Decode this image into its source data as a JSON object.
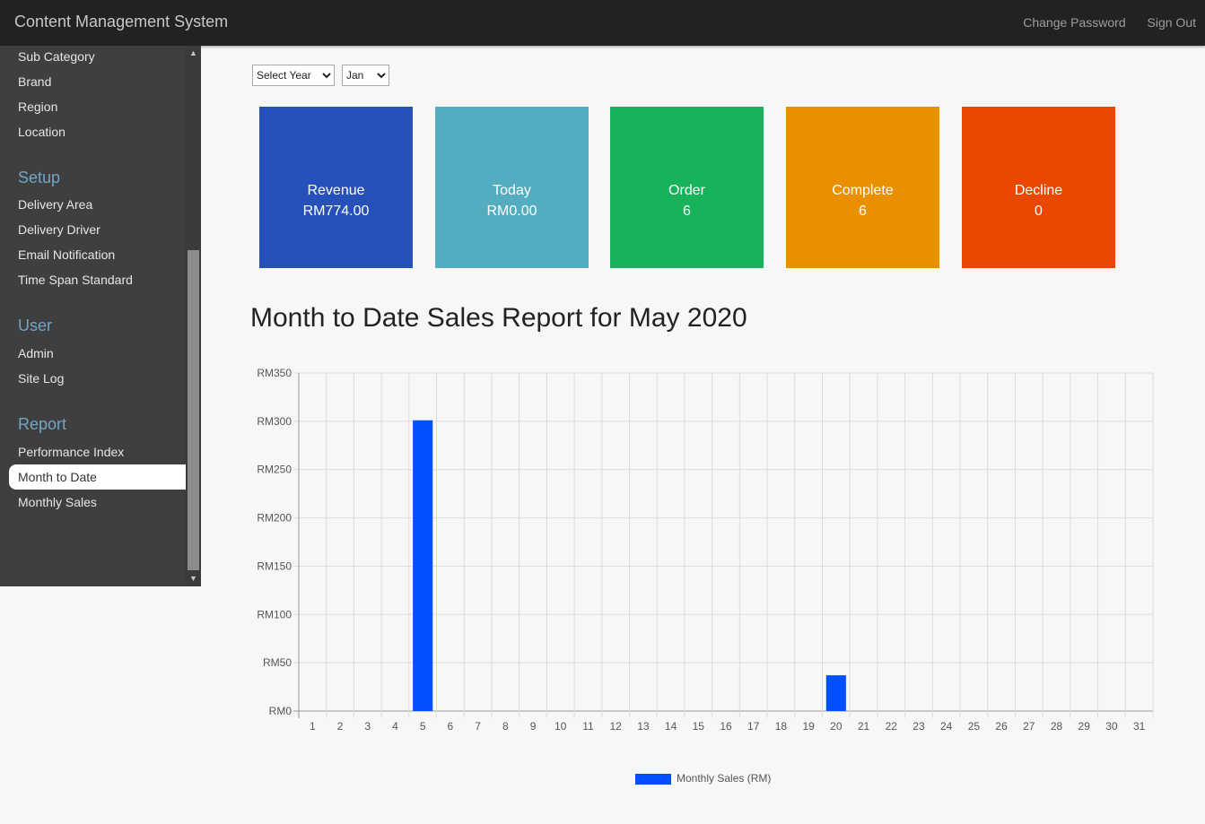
{
  "header": {
    "title": "Content Management System",
    "change_password": "Change Password",
    "sign_out": "Sign Out"
  },
  "sidebar": {
    "items_top": [
      "Sub Category",
      "Brand",
      "Region",
      "Location"
    ],
    "setup_heading": "Setup",
    "setup_items": [
      "Delivery Area",
      "Delivery Driver",
      "Email Notification",
      "Time Span Standard"
    ],
    "user_heading": "User",
    "user_items": [
      "Admin",
      "Site Log"
    ],
    "report_heading": "Report",
    "report_items": [
      "Performance Index",
      "Month to Date",
      "Monthly Sales"
    ],
    "active_item": "Month to Date"
  },
  "filters": {
    "year": "Select Year",
    "month": "Jan"
  },
  "tiles": [
    {
      "label": "Revenue",
      "value": "RM774.00",
      "color": "#2651b8"
    },
    {
      "label": "Today",
      "value": "RM0.00",
      "color": "#54acc0"
    },
    {
      "label": "Order",
      "value": "6",
      "color": "#17b25a"
    },
    {
      "label": "Complete",
      "value": "6",
      "color": "#ea9000"
    },
    {
      "label": "Decline",
      "value": "0",
      "color": "#ea4700"
    }
  ],
  "report_title": "Month to Date Sales Report for May 2020",
  "chart_data": {
    "type": "bar",
    "categories": [
      "1",
      "2",
      "3",
      "4",
      "5",
      "6",
      "7",
      "8",
      "9",
      "10",
      "11",
      "12",
      "13",
      "14",
      "15",
      "16",
      "17",
      "18",
      "19",
      "20",
      "21",
      "22",
      "23",
      "24",
      "25",
      "26",
      "27",
      "28",
      "29",
      "30",
      "31"
    ],
    "series": [
      {
        "name": "Monthly Sales (RM)",
        "values": [
          0,
          0,
          0,
          0,
          301,
          0,
          0,
          0,
          0,
          0,
          0,
          0,
          0,
          0,
          0,
          0,
          0,
          0,
          0,
          37,
          0,
          0,
          0,
          0,
          0,
          0,
          0,
          0,
          0,
          0,
          0,
          0
        ],
        "color": "#0050ff"
      }
    ],
    "y_ticks": [
      "RM0",
      "RM50",
      "RM100",
      "RM150",
      "RM200",
      "RM250",
      "RM300",
      "RM350"
    ],
    "ylim": [
      0,
      350
    ],
    "grid": true,
    "legend": "bottom"
  }
}
